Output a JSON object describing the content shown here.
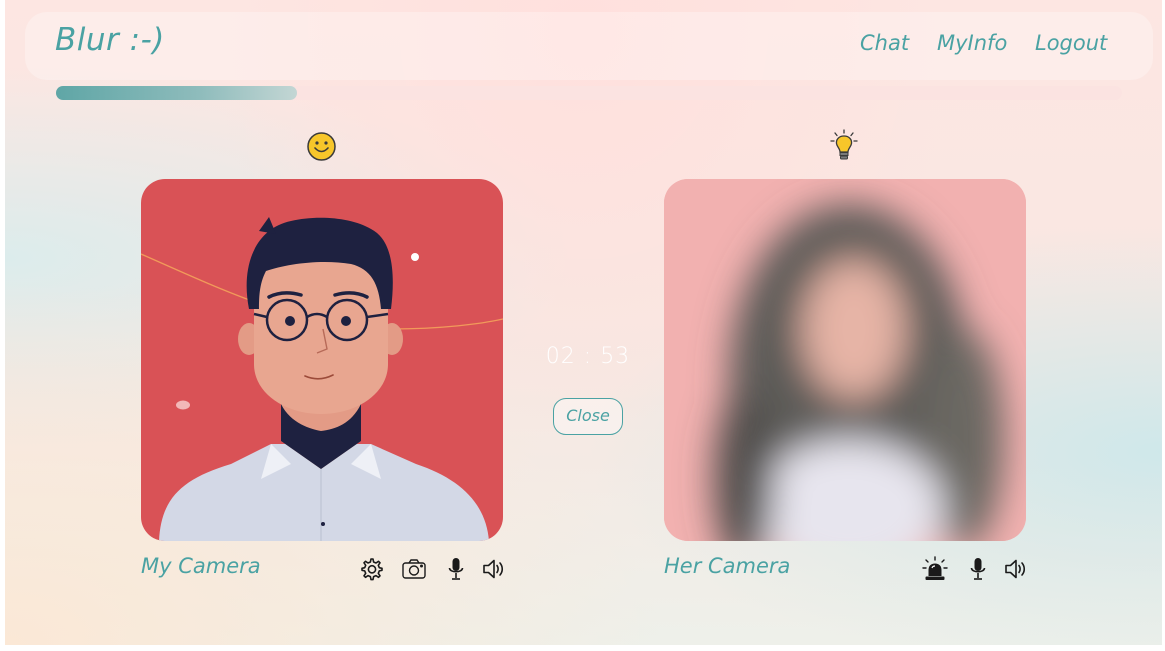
{
  "app": {
    "logo": "Blur :-)"
  },
  "nav": {
    "chat": "Chat",
    "myinfo": "MyInfo",
    "logout": "Logout"
  },
  "progress": {
    "fraction": 0.226
  },
  "session": {
    "timer": "02 : 53",
    "close_label": "Close"
  },
  "my_camera": {
    "label": "My Camera",
    "status_icon": "smiley-icon",
    "controls": [
      "settings-icon",
      "camera-icon",
      "microphone-icon",
      "speaker-icon"
    ]
  },
  "her_camera": {
    "label": "Her Camera",
    "status_icon": "lightbulb-icon",
    "controls": [
      "alarm-siren-icon",
      "microphone-icon",
      "speaker-icon"
    ]
  },
  "colors": {
    "accent": "#4aa2a3",
    "card_red": "#d95256",
    "card_pink": "#f3b2b0"
  }
}
